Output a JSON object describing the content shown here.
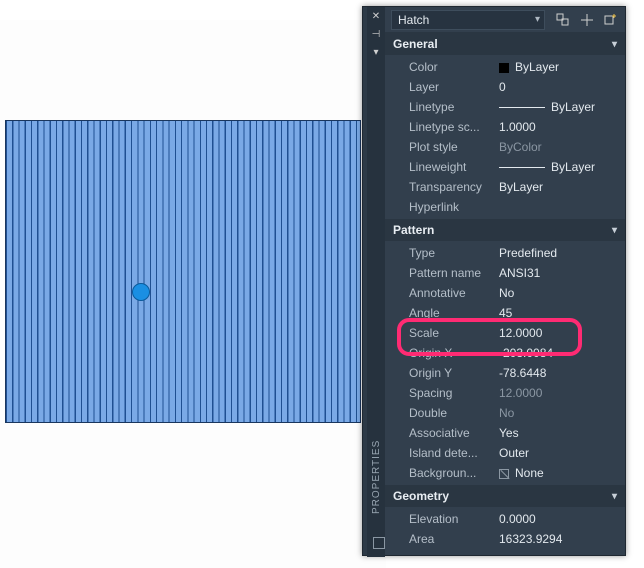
{
  "panel": {
    "title": "PROPERTIES",
    "type_selector": "Hatch"
  },
  "sections": {
    "general": {
      "header": "General",
      "color_label": "Color",
      "color_value": "ByLayer",
      "layer_label": "Layer",
      "layer_value": "0",
      "linetype_label": "Linetype",
      "linetype_value": "ByLayer",
      "ltscale_label": "Linetype sc...",
      "ltscale_value": "1.0000",
      "plotstyle_label": "Plot style",
      "plotstyle_value": "ByColor",
      "lineweight_label": "Lineweight",
      "lineweight_value": "ByLayer",
      "transparency_label": "Transparency",
      "transparency_value": "ByLayer",
      "hyperlink_label": "Hyperlink",
      "hyperlink_value": ""
    },
    "pattern": {
      "header": "Pattern",
      "type_label": "Type",
      "type_value": "Predefined",
      "name_label": "Pattern name",
      "name_value": "ANSI31",
      "annotative_label": "Annotative",
      "annotative_value": "No",
      "angle_label": "Angle",
      "angle_value": "45",
      "scale_label": "Scale",
      "scale_value": "12.0000",
      "originx_label": "Origin X",
      "originx_value": "-203.0084",
      "originy_label": "Origin Y",
      "originy_value": "-78.6448",
      "spacing_label": "Spacing",
      "spacing_value": "12.0000",
      "double_label": "Double",
      "double_value": "No",
      "associative_label": "Associative",
      "associative_value": "Yes",
      "island_label": "Island  dete...",
      "island_value": "Outer",
      "background_label": "Backgroun...",
      "background_value": "None"
    },
    "geometry": {
      "header": "Geometry",
      "elevation_label": "Elevation",
      "elevation_value": "0.0000",
      "area_label": "Area",
      "area_value": "16323.9294"
    }
  }
}
